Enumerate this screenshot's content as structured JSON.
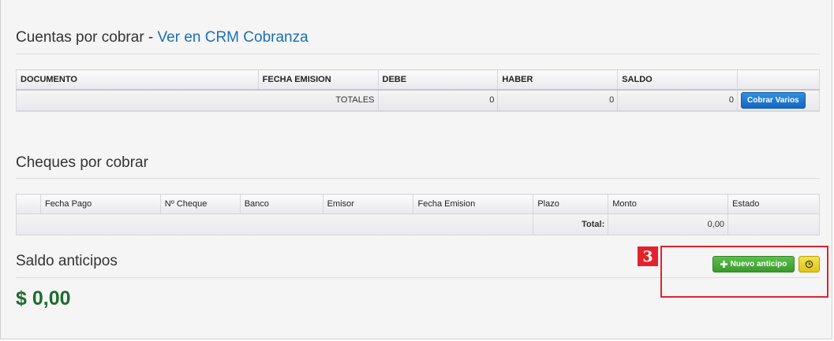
{
  "cuentas": {
    "title": "Cuentas por cobrar - ",
    "link": "Ver en CRM Cobranza",
    "columns": [
      "DOCUMENTO",
      "FECHA EMISION",
      "DEBE",
      "HABER",
      "SALDO"
    ],
    "totals_label": "TOTALES",
    "debe_total": "0",
    "haber_total": "0",
    "saldo_total": "0",
    "cobrar_button": "Cobrar Varios"
  },
  "cheques": {
    "title": "Cheques por cobrar",
    "columns": [
      "Fecha Pago",
      "Nº Cheque",
      "Banco",
      "Emisor",
      "Fecha Emision",
      "Plazo",
      "Monto",
      "Estado"
    ],
    "total_label": "Total:",
    "total_value": "0,00"
  },
  "anticipos": {
    "title": "Saldo anticipos",
    "amount": "$ 0,00",
    "nuevo_button": "Nuevo anticipo"
  },
  "annotation": {
    "number": "3",
    "color": "#e3232b"
  },
  "colors": {
    "link": "#1a6fb5",
    "amount": "#1f6b2e",
    "primary_button": "#1566c2",
    "success_button": "#3a9a2c",
    "warning_button": "#e0c419"
  },
  "icons": {
    "nuevo": "plus-icon",
    "history": "history-icon"
  }
}
